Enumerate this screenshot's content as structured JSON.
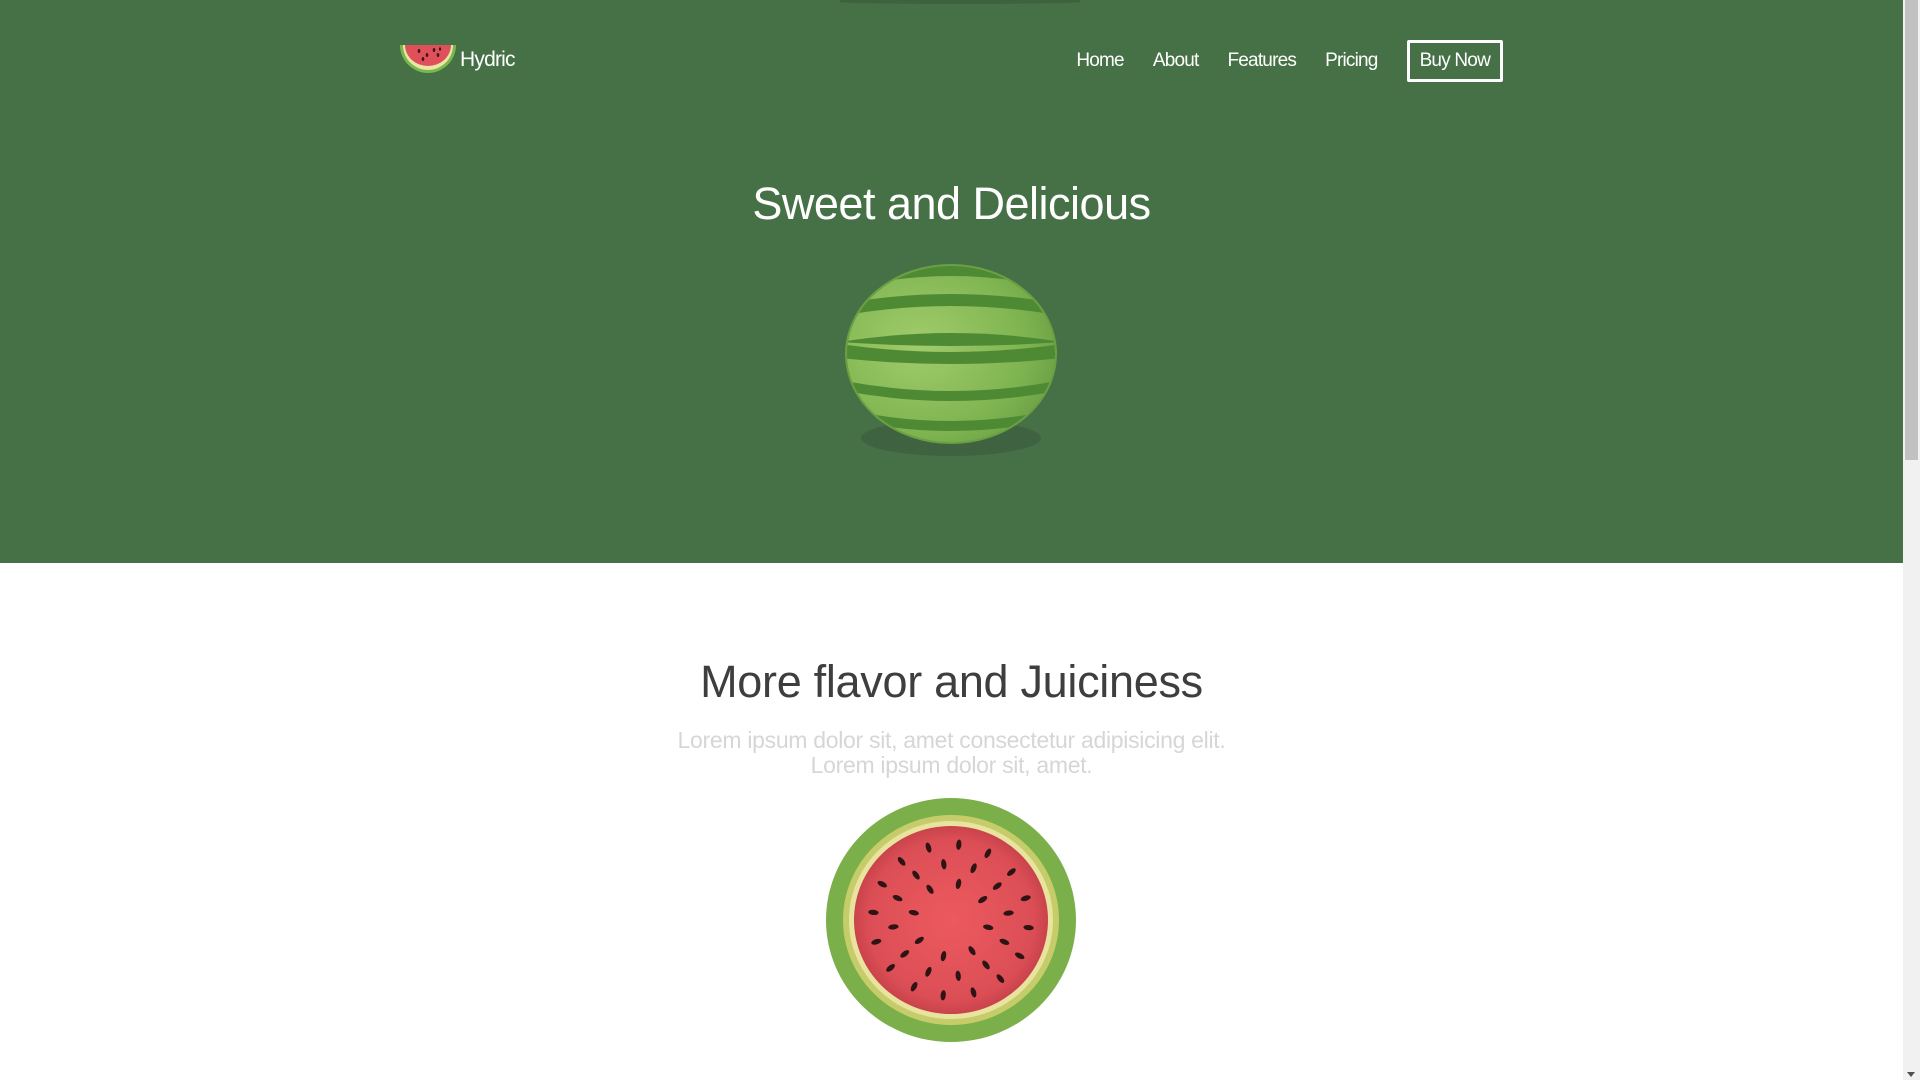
{
  "colors": {
    "hero_bg": "#467147",
    "white": "#ffffff",
    "heading_dark": "#3e3e3e",
    "subtext_light": "#d6d6d6",
    "rind_green": "#78ae4a",
    "flesh_red": "#e0505a",
    "seed": "#3a1a1a"
  },
  "brand": {
    "name": "Hydric",
    "logo_icon": "watermelon-slice-icon"
  },
  "nav": {
    "items": [
      {
        "label": "Home"
      },
      {
        "label": "About"
      },
      {
        "label": "Features"
      },
      {
        "label": "Pricing"
      }
    ],
    "cta_label": "Buy Now"
  },
  "hero": {
    "title": "Sweet and Delicious",
    "illustration": "whole-watermelon-icon"
  },
  "features": {
    "title": "More flavor and Juiciness",
    "subtitle_lines": [
      "Lorem ipsum dolor sit, amet consectetur adipisicing elit.",
      "Lorem ipsum dolor sit, amet."
    ],
    "illustration": "watermelon-cross-section-icon"
  }
}
